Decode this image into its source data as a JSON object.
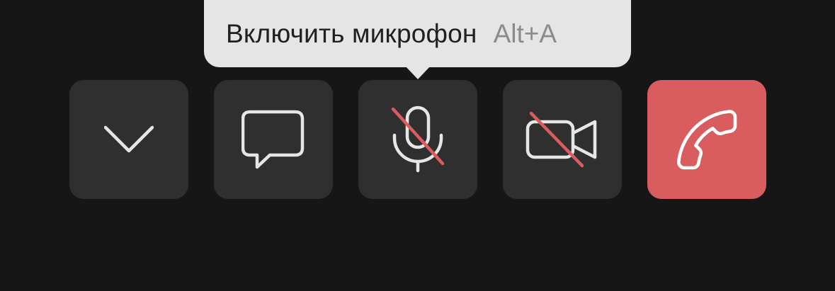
{
  "tooltip": {
    "label": "Включить микрофон",
    "shortcut": "Alt+A"
  },
  "controls": [
    {
      "name": "more",
      "icon": "chevron-down-icon"
    },
    {
      "name": "chat",
      "icon": "chat-bubble-icon"
    },
    {
      "name": "microphone",
      "icon": "microphone-muted-icon",
      "state": "off"
    },
    {
      "name": "camera",
      "icon": "camera-off-icon",
      "state": "off"
    },
    {
      "name": "end-call",
      "icon": "phone-hangup-icon"
    }
  ],
  "colors": {
    "background": "#161616",
    "button": "#2f2f2f",
    "end_call": "#d95c5e",
    "tooltip_bg": "#e5e5e5",
    "strike": "#d95c5e",
    "icon": "#e6e6e6"
  }
}
